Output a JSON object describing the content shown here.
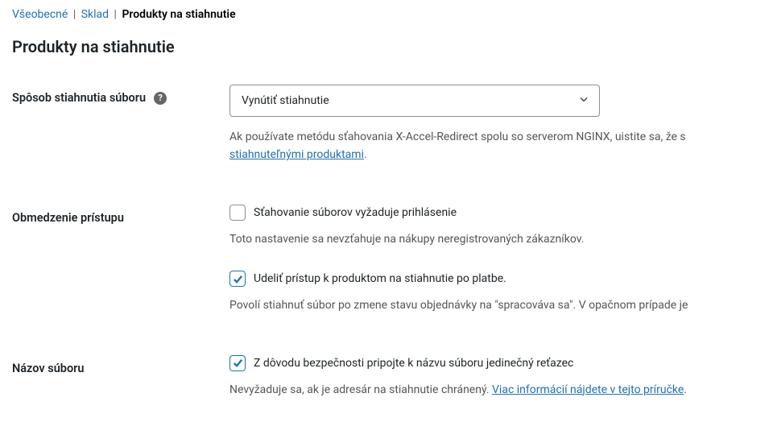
{
  "breadcrumb": {
    "general": "Všeobecné",
    "stock": "Sklad",
    "current": "Produkty na stiahnutie"
  },
  "page_title": "Produkty na stiahnutie",
  "download_method": {
    "label": "Spôsob stiahnutia súboru",
    "selected": "Vynútiť stiahnutie",
    "desc_before_link": "Ak používate metódu sťahovania X-Accel-Redirect spolu so serverom NGINX, uistite sa, že s",
    "link_text": "stiahnuteľnými produktami",
    "desc_after_link": "."
  },
  "access_restriction": {
    "label": "Obmedzenie prístupu",
    "require_login_label": "Sťahovanie súborov vyžaduje prihlásenie",
    "require_login_desc": "Toto nastavenie sa nevzťahuje na nákupy neregistrovaných zákazníkov.",
    "grant_access_label": "Udeliť prístup k produktom na stiahnutie po platbe.",
    "grant_access_desc": "Povolí stiahnuť súbor po zmene stavu objednávky na \"spracováva sa\". V opačnom prípade je"
  },
  "filename": {
    "label": "Názov súboru",
    "append_hash_label": "Z dôvodu bezpečnosti pripojte k názvu súboru jedinečný reťazec",
    "desc_before_link": "Nevyžaduje sa, ak je adresár na stiahnutie chránený. ",
    "link_text": "Viac informácií nájdete v tejto príručke",
    "desc_after_link": "."
  }
}
